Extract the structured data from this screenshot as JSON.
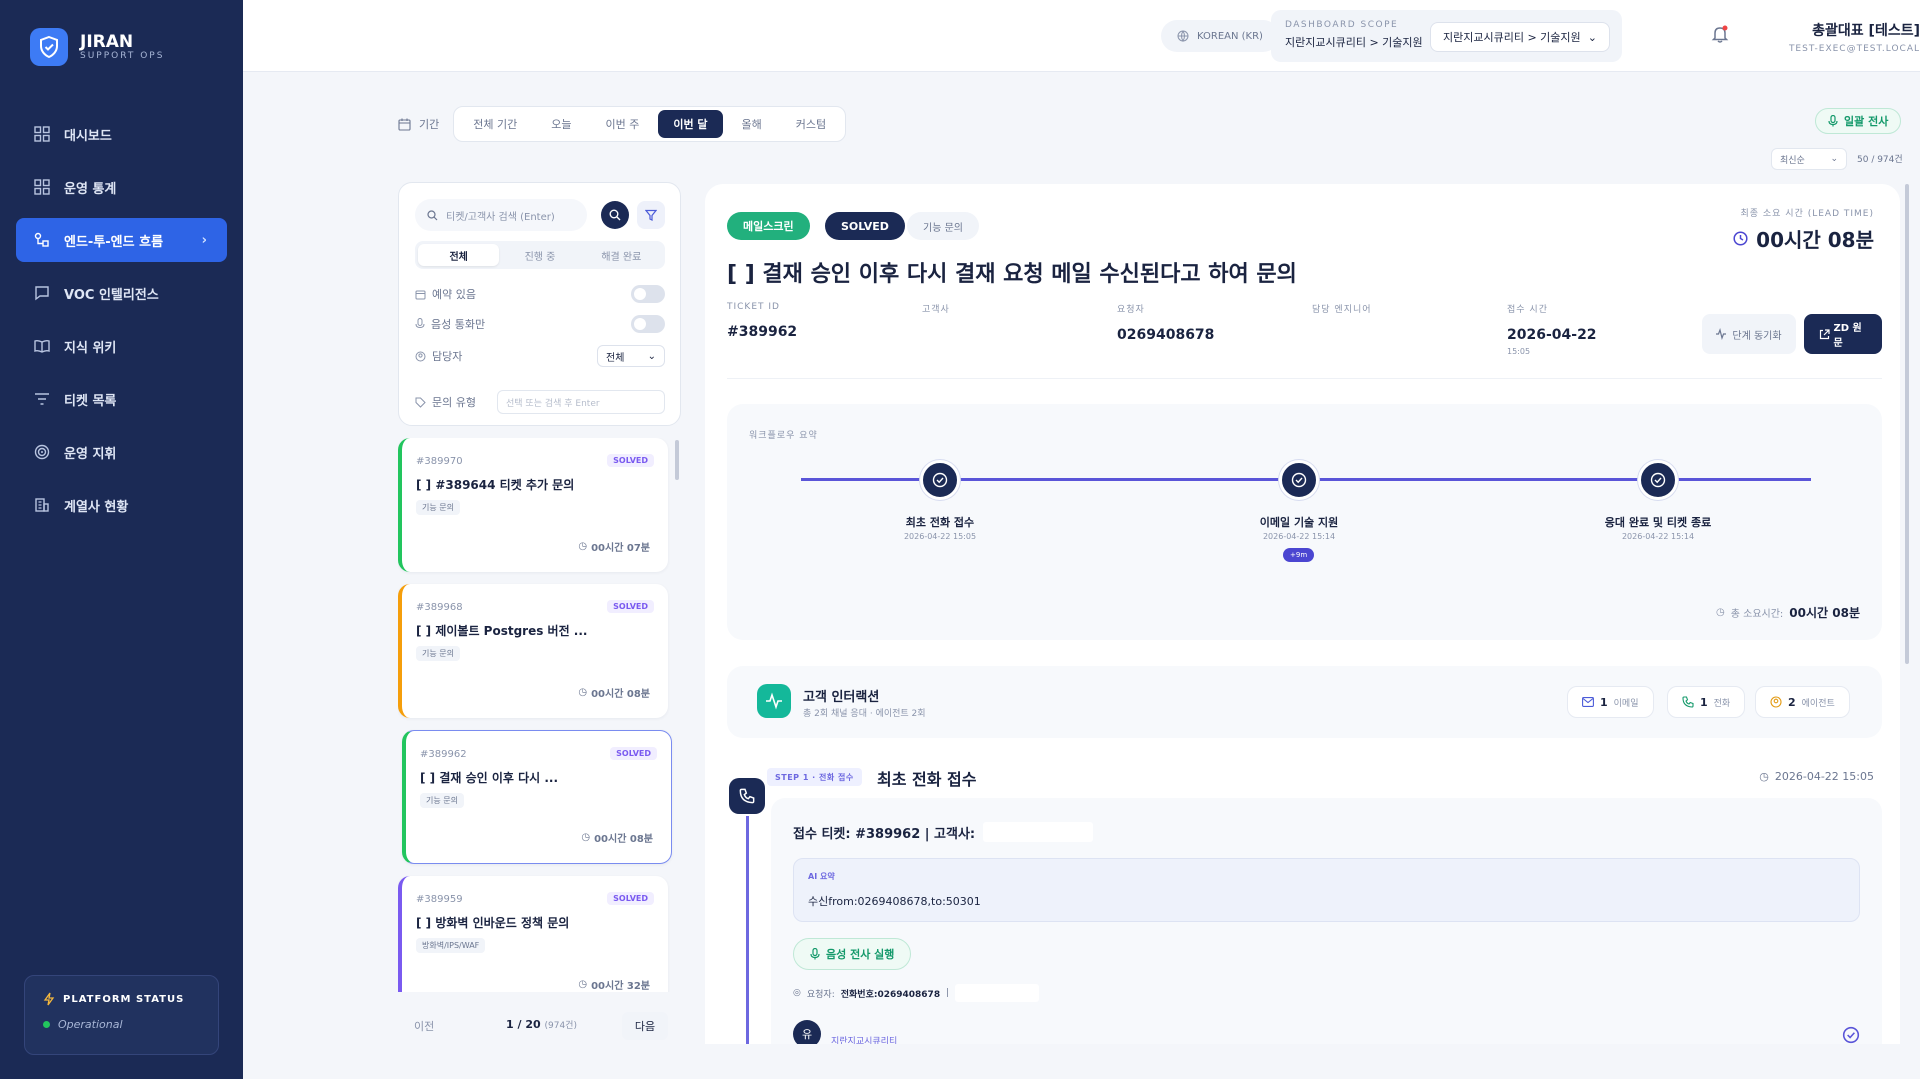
{
  "sidebar": {
    "brand_name": "JIRAN",
    "brand_sub": "SUPPORT OPS",
    "items": [
      {
        "label": "대시보드",
        "icon": "grid-icon"
      },
      {
        "label": "운영 통계",
        "icon": "grid-icon"
      },
      {
        "label": "엔드-투-엔드 흐름",
        "icon": "flow-icon",
        "active": true
      },
      {
        "label": "VOC 인텔리전스",
        "icon": "chat-icon"
      },
      {
        "label": "지식 위키",
        "icon": "book-icon"
      },
      {
        "label": "티켓 목록",
        "icon": "list-filter-icon"
      },
      {
        "label": "운영 지휘",
        "icon": "radar-icon"
      },
      {
        "label": "계열사 현황",
        "icon": "building-icon"
      }
    ],
    "status_title": "PLATFORM STATUS",
    "status_value": "Operational"
  },
  "topbar": {
    "language": "KOREAN (KR)",
    "scope_label": "DASHBOARD SCOPE",
    "scope_value": "지란지교시큐리티 > 기술지원",
    "scope_select": "지란지교시큐리티 > 기술지원",
    "user_name": "총괄대표 [테스트]",
    "user_email": "TEST-EXEC@TEST.LOCAL"
  },
  "period": {
    "label": "기간",
    "tabs": [
      "전체 기간",
      "오늘",
      "이번 주",
      "이번 달",
      "올해",
      "커스텀"
    ],
    "active_index": 3
  },
  "transcribe_all": "일괄 전사",
  "sort": {
    "selected": "최신순",
    "count": "50 / 974건"
  },
  "filters": {
    "search_placeholder": "티켓/고객사 검색 (Enter)",
    "segments": [
      "전체",
      "진행 중",
      "해결 완료"
    ],
    "reserve_label": "예약 있음",
    "voice_label": "음성 통화만",
    "assignee_label": "담당자",
    "assignee_value": "전체",
    "type_label": "문의 유형",
    "type_placeholder": "선택 또는 검색 후 Enter"
  },
  "tickets": [
    {
      "id": "#389970",
      "status": "SOLVED",
      "title": "[                    ] #389644 티켓 추가 문의",
      "tag": "기능 문의",
      "time": "00시간 07분",
      "color": "#22c55e"
    },
    {
      "id": "#389968",
      "status": "SOLVED",
      "title": "[                    ] 제이볼트 Postgres 버전 ...",
      "tag": "기능 문의",
      "time": "00시간 08분",
      "color": "#f59e0b"
    },
    {
      "id": "#389962",
      "status": "SOLVED",
      "title": "[                         ] 결재 승인 이후 다시 ...",
      "tag": "기능 문의",
      "time": "00시간 08분",
      "color": "#22c55e",
      "selected": true
    },
    {
      "id": "#389959",
      "status": "SOLVED",
      "title": "[           ] 방화벽 인바운드 정책 문의",
      "tag": "방화벽/IPS/WAF",
      "time": "00시간 32분",
      "color": "#7a5af0"
    }
  ],
  "pager": {
    "prev": "이전",
    "info": "1 / 20",
    "sub": "(974건)",
    "next": "다음"
  },
  "detail": {
    "pills": [
      "메일스크린",
      "SOLVED",
      "기능 문의"
    ],
    "lead_label": "최종 소요 시간 (LEAD TIME)",
    "lead_value": "00시간 08분",
    "title": "[                              ] 결재 승인 이후 다시 결재 요청 메일 수신된다고 하여 문의",
    "meta": [
      {
        "label": "TICKET ID",
        "value": "#389962"
      },
      {
        "label": "고객사",
        "value": ""
      },
      {
        "label": "요청자",
        "value": "0269408678"
      },
      {
        "label": "담당 엔지니어",
        "value": ""
      },
      {
        "label": "접수 시간",
        "value": "2026-04-22",
        "sub": "15:05"
      }
    ],
    "sync_label": "단계 동기화",
    "zd_label": "ZD 원문",
    "workflow": {
      "label": "워크플로우 요약",
      "steps": [
        {
          "title": "최초 전화 접수",
          "time": "2026-04-22 15:05"
        },
        {
          "title": "이메일 기술 지원",
          "time": "2026-04-22 15:14",
          "delta": "+9m"
        },
        {
          "title": "응대 완료 및 티켓 종료",
          "time": "2026-04-22 15:14"
        }
      ],
      "total_label": "총 소요시간:",
      "total_value": "00시간 08분"
    },
    "interaction": {
      "title": "고객 인터랙션",
      "sub": "총 2회 채널 응대 · 에이전트 2회",
      "email_count": "1",
      "email_label": "이메일",
      "call_count": "1",
      "call_label": "전화",
      "agent_count": "2",
      "agent_label": "에이전트"
    },
    "step1": {
      "badge": "STEP 1 · 전화 접수",
      "title": "최초 전화 접수",
      "date": "2026-04-22 15:05",
      "head": "접수 티켓: #389962 | 고객사:",
      "ai_label": "AI 요약",
      "ai_text": "수신from:0269408678,to:50301",
      "run_label": "음성 전사 실행",
      "requester_label": "요청자:",
      "requester_value": "전화번호:0269408678",
      "avatar": "유",
      "avatar_name": "지란지교시큐리티"
    }
  },
  "colors": {
    "sidebar": "#1b2a55",
    "accent": "#2e64e6",
    "green": "#14b89a"
  }
}
